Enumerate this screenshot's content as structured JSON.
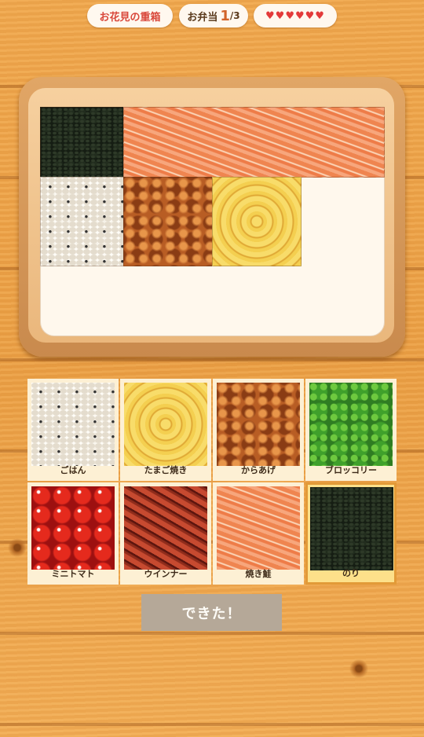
{
  "header": {
    "title": "お花見の重箱",
    "counter_label": "お弁当",
    "counter_current": "1",
    "counter_total": "/3",
    "lives": "♥♥♥♥♥♥"
  },
  "palette": [
    {
      "name": "ごはん",
      "food": "rice"
    },
    {
      "name": "たまご焼き",
      "food": "egg"
    },
    {
      "name": "からあげ",
      "food": "karaage"
    },
    {
      "name": "ブロッコリー",
      "food": "broccoli"
    },
    {
      "name": "ミニトマト",
      "food": "tomato"
    },
    {
      "name": "ウインナー",
      "food": "wiener"
    },
    {
      "name": "焼き鮭",
      "food": "salmon"
    },
    {
      "name": "のり",
      "food": "nori",
      "selected": true
    }
  ],
  "box_placed": [
    "nori",
    "salmon",
    "rice",
    "karaage",
    "egg"
  ],
  "done_button": "できた！",
  "colors": {
    "accent": "#e29a38",
    "title": "#d9483b",
    "heart": "#e33a3a",
    "button": "#b5a898"
  }
}
